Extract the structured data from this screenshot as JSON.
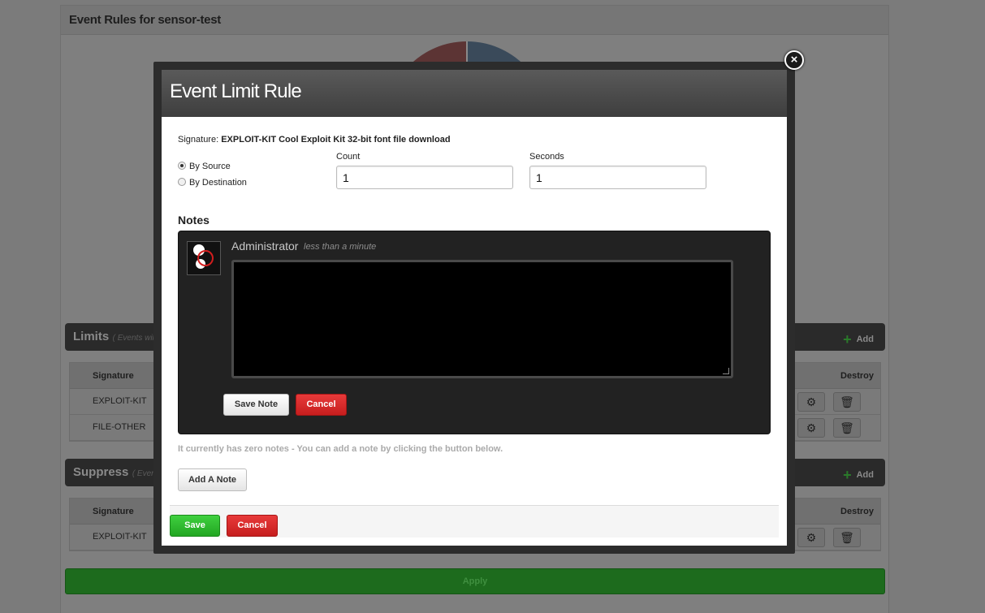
{
  "background": {
    "title": "Event Rules for sensor-test",
    "limits": {
      "title": "Limits",
      "subtitle": "( Events will b",
      "add_label": "Add",
      "col_signature": "Signature",
      "col_destroy": "Destroy",
      "rows": [
        "EXPLOIT-KIT",
        "FILE-OTHER"
      ]
    },
    "suppress": {
      "title": "Suppress",
      "subtitle": "( Event",
      "add_label": "Add",
      "col_signature": "Signature",
      "col_destroy": "Destroy",
      "rows": [
        "EXPLOIT-KIT"
      ]
    },
    "apply_label": "Apply"
  },
  "modal": {
    "title": "Event Limit Rule",
    "close_glyph": "×",
    "signature_label": "Signature:",
    "signature_value": "EXPLOIT-KIT Cool Exploit Kit 32-bit font file download",
    "by_source": "By Source",
    "by_destination": "By Destination",
    "selected_track": "by_source",
    "count_label": "Count",
    "count_value": "1",
    "seconds_label": "Seconds",
    "seconds_value": "1",
    "notes_heading": "Notes",
    "note": {
      "author": "Administrator",
      "time": "less than a minute",
      "text": ""
    },
    "save_note_label": "Save Note",
    "cancel_note_label": "Cancel",
    "hint": "It currently has zero notes - You can add a note by clicking the button below.",
    "add_note_label": "Add A Note",
    "save_label": "Save",
    "cancel_label": "Cancel"
  },
  "icons": {
    "gear": "gear-icon",
    "trash": "trash-icon",
    "close": "close-icon",
    "plus": "plus-icon"
  },
  "colors": {
    "save_green": "#22a622",
    "cancel_red": "#c61e1e",
    "apply_green": "#1d6b1d"
  }
}
